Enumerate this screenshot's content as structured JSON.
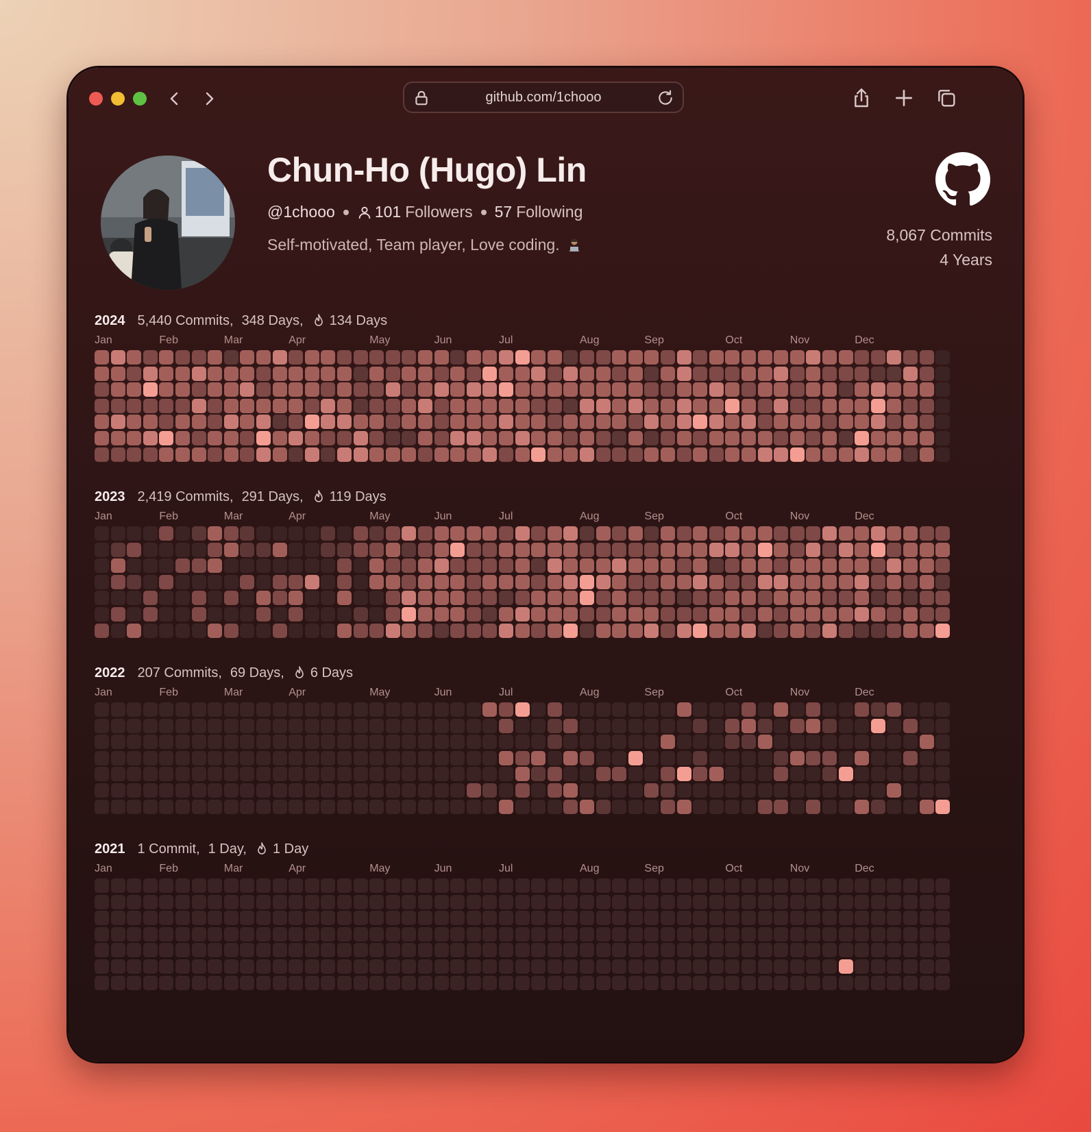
{
  "browser": {
    "url": "github.com/1chooo",
    "icons": [
      "back-icon",
      "forward-icon",
      "lock-icon",
      "reload-icon",
      "share-icon",
      "new-tab-icon",
      "tabs-icon"
    ]
  },
  "profile": {
    "name": "Chun-Ho (Hugo) Lin",
    "handle": "@1chooo",
    "followers_count": "101",
    "followers_label": "Followers",
    "following_count": "57",
    "following_label": "Following",
    "bio": "Self-motivated, Team player, Love coding.",
    "bio_emoji": "technologist-icon",
    "total_commits": "8,067 Commits",
    "total_years": "4 Years"
  },
  "colors": {
    "level0": "#3c2323",
    "level1": "#5d3636",
    "level2": "#7e4947",
    "level3": "#a25f5a",
    "level4": "#c97c75",
    "level5": "#f49e93",
    "accent": "#ffb3a6"
  },
  "months": [
    "Jan",
    "Feb",
    "Mar",
    "Apr",
    "May",
    "Jun",
    "Jul",
    "Aug",
    "Sep",
    "Oct",
    "Nov",
    "Dec"
  ],
  "years": [
    {
      "year": "2024",
      "commits": "5,440 Commits,",
      "days": "348 Days,",
      "streak": "134 Days",
      "month_weeks": [
        0,
        4,
        8,
        12,
        17,
        21,
        25,
        30,
        34,
        39,
        43,
        47
      ],
      "weeks": [
        "0342523242323322433410",
        "5332543424544444433322",
        "3232443433333333433332",
        "5223333434323433232335",
        "2223444433233433232302",
        "2223443424433333332332",
        "2232344244343342332333",
        "1222334434343432343323",
        "2222224333333322323434",
        "3333323353333343323334",
        "2223333343333332233333",
        "3232343323332323333322",
        "2243444433332322323433",
        "3223434444334332332333",
        "2234333232343323333233",
        "3342333332333422333323",
        "3233433223334333424333",
        "3433333322222222223322",
        "1121333333333333342333",
        "2232332343334223424333",
        "2333454334434333432443",
        "3434434434433333534334",
        "3232234333333333443333",
        "2333333333343343343333",
        "3442433333433433435433",
        "3333433333433333333435",
        "3333333333333333534333",
        "2333333333433434333333",
        "3333333333334334333333",
        "3333443343343334333333",
        "3333333333343343434333",
        "1212333333333333333332"
      ]
    },
    {
      "year": "2023",
      "commits": "2,419 Commits,",
      "days": "291 Days,",
      "streak": "119 Days",
      "month_weeks": [
        0,
        4,
        8,
        12,
        17,
        21,
        25,
        30,
        34,
        39,
        43,
        47
      ],
      "weeks": [],
      "dense": [
        "1221311331231222334455243",
        "2111242223333223334544333",
        "1312121223333332343443233",
        "3112231233333333443344343",
        "1111232233344233334343543",
        "1232121223323332344333343",
        "1311132233333333343353433"
      ]
    },
    {
      "year": "2022",
      "commits": "207 Commits,",
      "days": "69 Days,",
      "streak": "6 Days",
      "month_weeks": [
        0,
        4,
        8,
        12,
        17,
        21,
        25,
        30,
        34,
        39,
        43,
        47
      ]
    },
    {
      "year": "2021",
      "commits": "1 Commit,",
      "days": "1 Day,",
      "streak": "1 Day",
      "month_weeks": [
        0,
        4,
        8,
        12,
        17,
        21,
        25,
        30,
        34,
        39,
        43,
        47
      ]
    }
  ]
}
